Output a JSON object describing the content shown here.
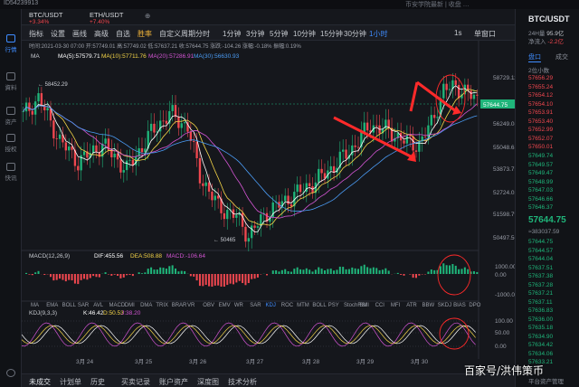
{
  "window": {
    "id_text": "ID54239913",
    "notice": "币安学院最新 | 收盘 …"
  },
  "nav": [
    {
      "label": "行情",
      "icon": "market-icon",
      "active": true
    },
    {
      "label": "資料",
      "icon": "info-icon",
      "active": false
    },
    {
      "label": "资产",
      "icon": "wallet-icon",
      "active": false
    },
    {
      "label": "授权",
      "icon": "auth-icon",
      "active": false
    },
    {
      "label": "快讯",
      "icon": "news-icon",
      "active": false
    }
  ],
  "tabs": [
    {
      "name": "BTC/USDT",
      "change": "+3.34%"
    },
    {
      "name": "ETH/USDT",
      "change": "+7.40%"
    }
  ],
  "toolbar": {
    "items": [
      "指标",
      "设置",
      "画线",
      "高级",
      "自选",
      "胜率",
      "自定义周期",
      "分时",
      "1分钟",
      "3分钟",
      "5分钟",
      "10分钟",
      "15分钟",
      "30分钟",
      "1小时"
    ],
    "active": "1小时",
    "right_1s": "1s",
    "right_single": "单窗口"
  },
  "chart_data": {
    "type": "candlestick",
    "info_line": "时间:2021-03-30 07:00  开:57749.01  高:57749.02  低:57637.21  收:57644.75  涨跌:-104.26  涨幅:-0.18%  振幅:0.19%",
    "ma_line": {
      "label": "MA",
      "ma5": "MA(5):57579.71",
      "ma10": "MA(10):57711.76",
      "ma20": "MA(20):57286.91",
      "ma30": "MA(30):56630.93"
    },
    "y_ticks": [
      "58729.11",
      "57644.75",
      "56249.08",
      "55048.63",
      "53873.75",
      "52724.02",
      "51598.79",
      "50497.56"
    ],
    "last_price": "57644.75",
    "high_marker": "58452.29",
    "low_marker": "50465",
    "macd": {
      "label": "MACD(12,26,9)",
      "dif": "DIF:455.56",
      "dea": "DEA:508.88",
      "macd": "MACD:-106.64",
      "y_ticks": [
        "1000.00",
        "0.00",
        "-1000.00"
      ]
    },
    "kdj": {
      "label": "KDJ(9,3,3)",
      "k": "K:46.42",
      "d": "D:50.53",
      "j": "J:38.20",
      "y_ticks": [
        "100.00",
        "50.00",
        "0.00"
      ]
    },
    "x_ticks": [
      "3月 24",
      "3月 25",
      "3月 26",
      "3月 27",
      "3月 28",
      "3月 29",
      "3月 30"
    ],
    "indicators": [
      "MA",
      "EMA",
      "BOLL",
      "SAR",
      "AVL",
      "MACD",
      "DMI",
      "DMA",
      "TRIX",
      "BRAR",
      "VR",
      "OBV",
      "EMV",
      "WR",
      "SAR",
      "KDJ",
      "ROC",
      "MTM",
      "BOLL",
      "PSY",
      "StochRSI",
      "SMI",
      "CCI",
      "MFI",
      "ATR",
      "BBW",
      "SKDJ",
      "BIAS",
      "DPO"
    ],
    "colors": {
      "up": "#1fb57a",
      "down": "#f0474f",
      "ma5": "#ffffff",
      "ma10": "#f5d547",
      "ma20": "#d455d4",
      "ma30": "#4b9cf5",
      "annotation": "#ff2a2a"
    }
  },
  "bottom_tabs": [
    "未成交",
    "计划单",
    "历史",
    "买卖记录",
    "账户资产",
    "深度图",
    "技术分析"
  ],
  "right_panel": {
    "symbol": "BTC/USDT",
    "info1": "24H量",
    "info1_val": "95.9亿",
    "info2": "净流入",
    "info2_val": "-2.2亿",
    "tab_active": "盘口",
    "tab_other": "成交",
    "depth_label": "2位小数",
    "asks": [
      "57656.29",
      "57655.24",
      "57654.12",
      "57654.10",
      "57653.91",
      "57653.40",
      "57652.99",
      "57652.07",
      "57650.01"
    ],
    "bids": [
      "57649.74",
      "57649.57",
      "57649.47",
      "57648.99",
      "57647.03",
      "57646.66",
      "57646.37"
    ],
    "last": "57644.75",
    "last_sub": "≈383037.59",
    "bids2": [
      "57644.75",
      "57644.57",
      "57644.04",
      "57637.51",
      "57637.38",
      "57637.28",
      "57637.21",
      "57637.11",
      "57636.83",
      "57636.00",
      "57635.18",
      "57634.90",
      "57634.42",
      "57634.06",
      "57633.21"
    ],
    "footer": "平台资产管理"
  },
  "watermark": "百家号/洪伟策币"
}
